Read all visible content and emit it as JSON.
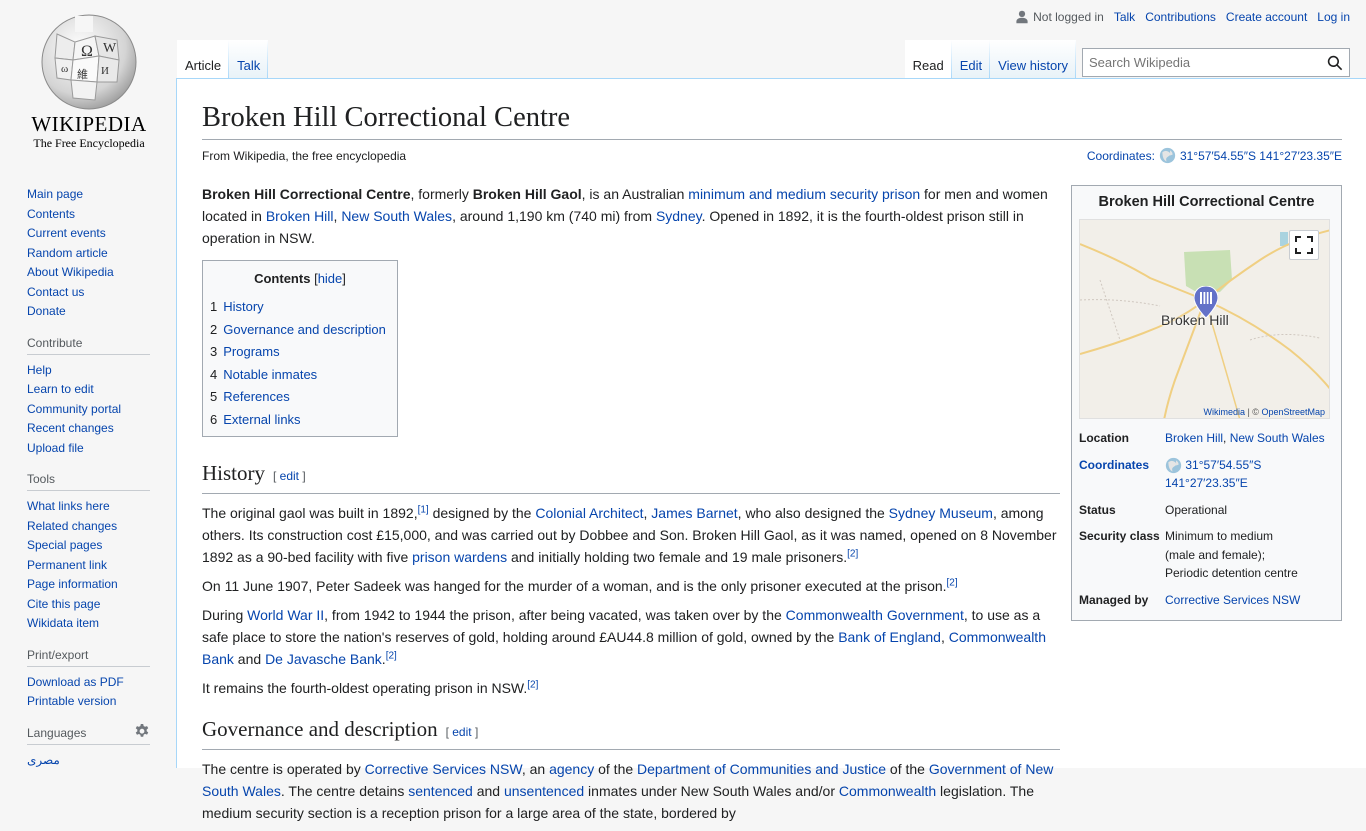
{
  "logo": {
    "wordmark": "WIKIPEDIA",
    "tagline": "The Free Encyclopedia"
  },
  "personal": {
    "not_logged_in": "Not logged in",
    "links": [
      "Talk",
      "Contributions",
      "Create account",
      "Log in"
    ]
  },
  "tabs": {
    "left": [
      "Article",
      "Talk"
    ],
    "right": [
      "Read",
      "Edit",
      "View history"
    ]
  },
  "search": {
    "placeholder": "Search Wikipedia"
  },
  "sidebar": {
    "navigation": [
      "Main page",
      "Contents",
      "Current events",
      "Random article",
      "About Wikipedia",
      "Contact us",
      "Donate"
    ],
    "contribute": {
      "title": "Contribute",
      "items": [
        "Help",
        "Learn to edit",
        "Community portal",
        "Recent changes",
        "Upload file"
      ]
    },
    "tools": {
      "title": "Tools",
      "items": [
        "What links here",
        "Related changes",
        "Special pages",
        "Permanent link",
        "Page information",
        "Cite this page",
        "Wikidata item"
      ]
    },
    "print": {
      "title": "Print/export",
      "items": [
        "Download as PDF",
        "Printable version"
      ]
    },
    "languages": {
      "title": "Languages",
      "items": [
        "مصرى"
      ]
    }
  },
  "article": {
    "title": "Broken Hill Correctional Centre",
    "site_sub": "From Wikipedia, the free encyclopedia",
    "coordinates_label": "Coordinates:",
    "coordinates_value": "31°57′54.55″S 141°27′23.35″E",
    "intro": {
      "b1": "Broken Hill Correctional Centre",
      "t1": ", formerly ",
      "b2": "Broken Hill Gaol",
      "t2": ", is an Australian ",
      "l1": "minimum and medium security prison",
      "t3": " for men and women located in ",
      "l2": "Broken Hill",
      "t4": ", ",
      "l3": "New South Wales",
      "t5": ", around 1,190 km (740 mi) from ",
      "l4": "Sydney",
      "t6": ". Opened in 1892, it is the fourth-oldest prison still in operation in NSW."
    },
    "toc": {
      "title": "Contents",
      "hide": "hide",
      "items": [
        {
          "num": "1",
          "label": "History"
        },
        {
          "num": "2",
          "label": "Governance and description"
        },
        {
          "num": "3",
          "label": "Programs"
        },
        {
          "num": "4",
          "label": "Notable inmates"
        },
        {
          "num": "5",
          "label": "References"
        },
        {
          "num": "6",
          "label": "External links"
        }
      ]
    },
    "edit_label": "edit",
    "history": {
      "heading": "History",
      "p1": {
        "t1": "The original gaol was built in 1892,",
        "ref1": "[1]",
        "t2": " designed by the ",
        "l1": "Colonial Architect",
        "t3": ", ",
        "l2": "James Barnet",
        "t4": ", who also designed the ",
        "l3": "Sydney Museum",
        "t5": ", among others. Its construction cost £15,000, and was carried out by Dobbee and Son. Broken Hill Gaol, as it was named, opened on 8 November 1892 as a 90-bed facility with five ",
        "l4": "prison wardens",
        "t6": " and initially holding two female and 19 male prisoners.",
        "ref2": "[2]"
      },
      "p2": {
        "t1": "On 11 June 1907, Peter Sadeek was hanged for the murder of a woman, and is the only prisoner executed at the prison.",
        "ref": "[2]"
      },
      "p3": {
        "t1": "During ",
        "l1": "World War II",
        "t2": ", from 1942 to 1944 the prison, after being vacated, was taken over by the ",
        "l2": "Commonwealth Government",
        "t3": ", to use as a safe place to store the nation's reserves of gold, holding around £AU44.8 million of gold, owned by the ",
        "l3": "Bank of England",
        "t4": ", ",
        "l4": "Commonwealth Bank",
        "t5": " and ",
        "l5": "De Javasche Bank",
        "t6": ".",
        "ref": "[2]"
      },
      "p4": {
        "t1": "It remains the fourth-oldest operating prison in NSW.",
        "ref": "[2]"
      }
    },
    "governance": {
      "heading": "Governance and description",
      "p1": {
        "t1": "The centre is operated by ",
        "l1": "Corrective Services NSW",
        "t2": ", an ",
        "l2": "agency",
        "t3": " of the ",
        "l3": "Department of Communities and Justice",
        "t4": " of the ",
        "l4": "Government of New South Wales",
        "t5": ". The centre detains ",
        "l5": "sentenced",
        "t6": " and ",
        "l6": "unsentenced",
        "t7": " inmates under New South Wales and/or ",
        "l7": "Commonwealth",
        "t8": " legislation. The medium security section is a reception prison for a large area of the state, bordered by"
      }
    }
  },
  "infobox": {
    "title": "Broken Hill Correctional Centre",
    "map": {
      "city_label": "Broken Hill",
      "attr_wikimedia": "Wikimedia",
      "attr_sep": " | © ",
      "attr_osm": "OpenStreetMap"
    },
    "rows": {
      "location_label": "Location",
      "location_l1": "Broken Hill",
      "location_sep": ", ",
      "location_l2": "New South Wales",
      "coordinates_label": "Coordinates",
      "coord_line1": "31°57′54.55″S",
      "coord_line2": "141°27′23.35″E",
      "status_label": "Status",
      "status_value": "Operational",
      "security_label": "Security class",
      "security_line1": "Minimum to medium",
      "security_line2": "(male and female);",
      "security_line3": "Periodic detention centre",
      "managed_label": "Managed by",
      "managed_value": "Corrective Services NSW"
    }
  }
}
